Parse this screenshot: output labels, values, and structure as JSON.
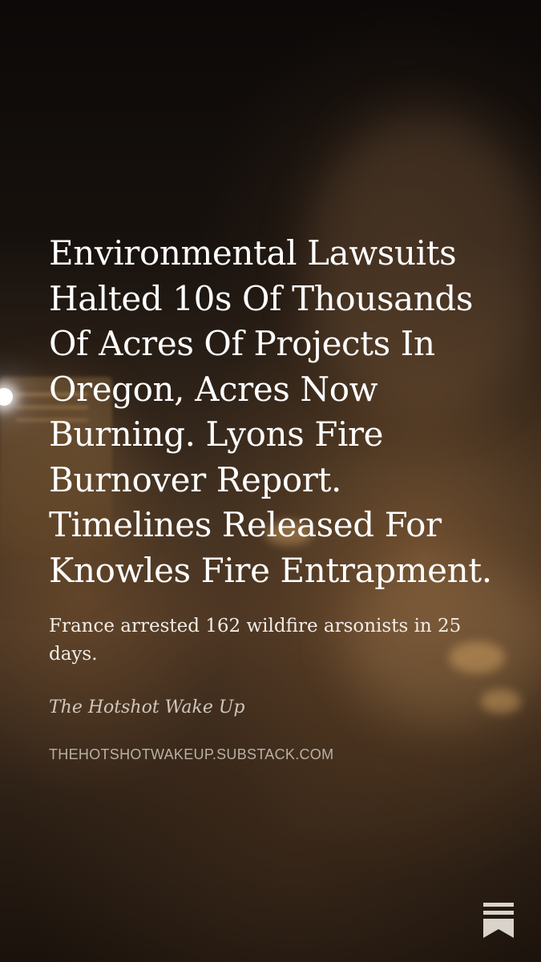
{
  "post": {
    "title": "Environmental Lawsuits Halted 10s Of Thousands Of Acres Of Projects In Oregon, Acres Now Burning. Lyons Fire Burnover Report. Timelines Released For Knowles Fire Entrapment.",
    "subtitle": "France arrested 162 wildfire arsonists in 25 days.",
    "publication": "The Hotshot Wake Up",
    "domain": "THEHOTSHOTWAKEUP.SUBSTACK.COM"
  },
  "icons": {
    "logo": "substack-logo-icon"
  },
  "colors": {
    "text": "#ffffff",
    "muted": "#b8b0a6",
    "logo": "#d9d3cc"
  }
}
